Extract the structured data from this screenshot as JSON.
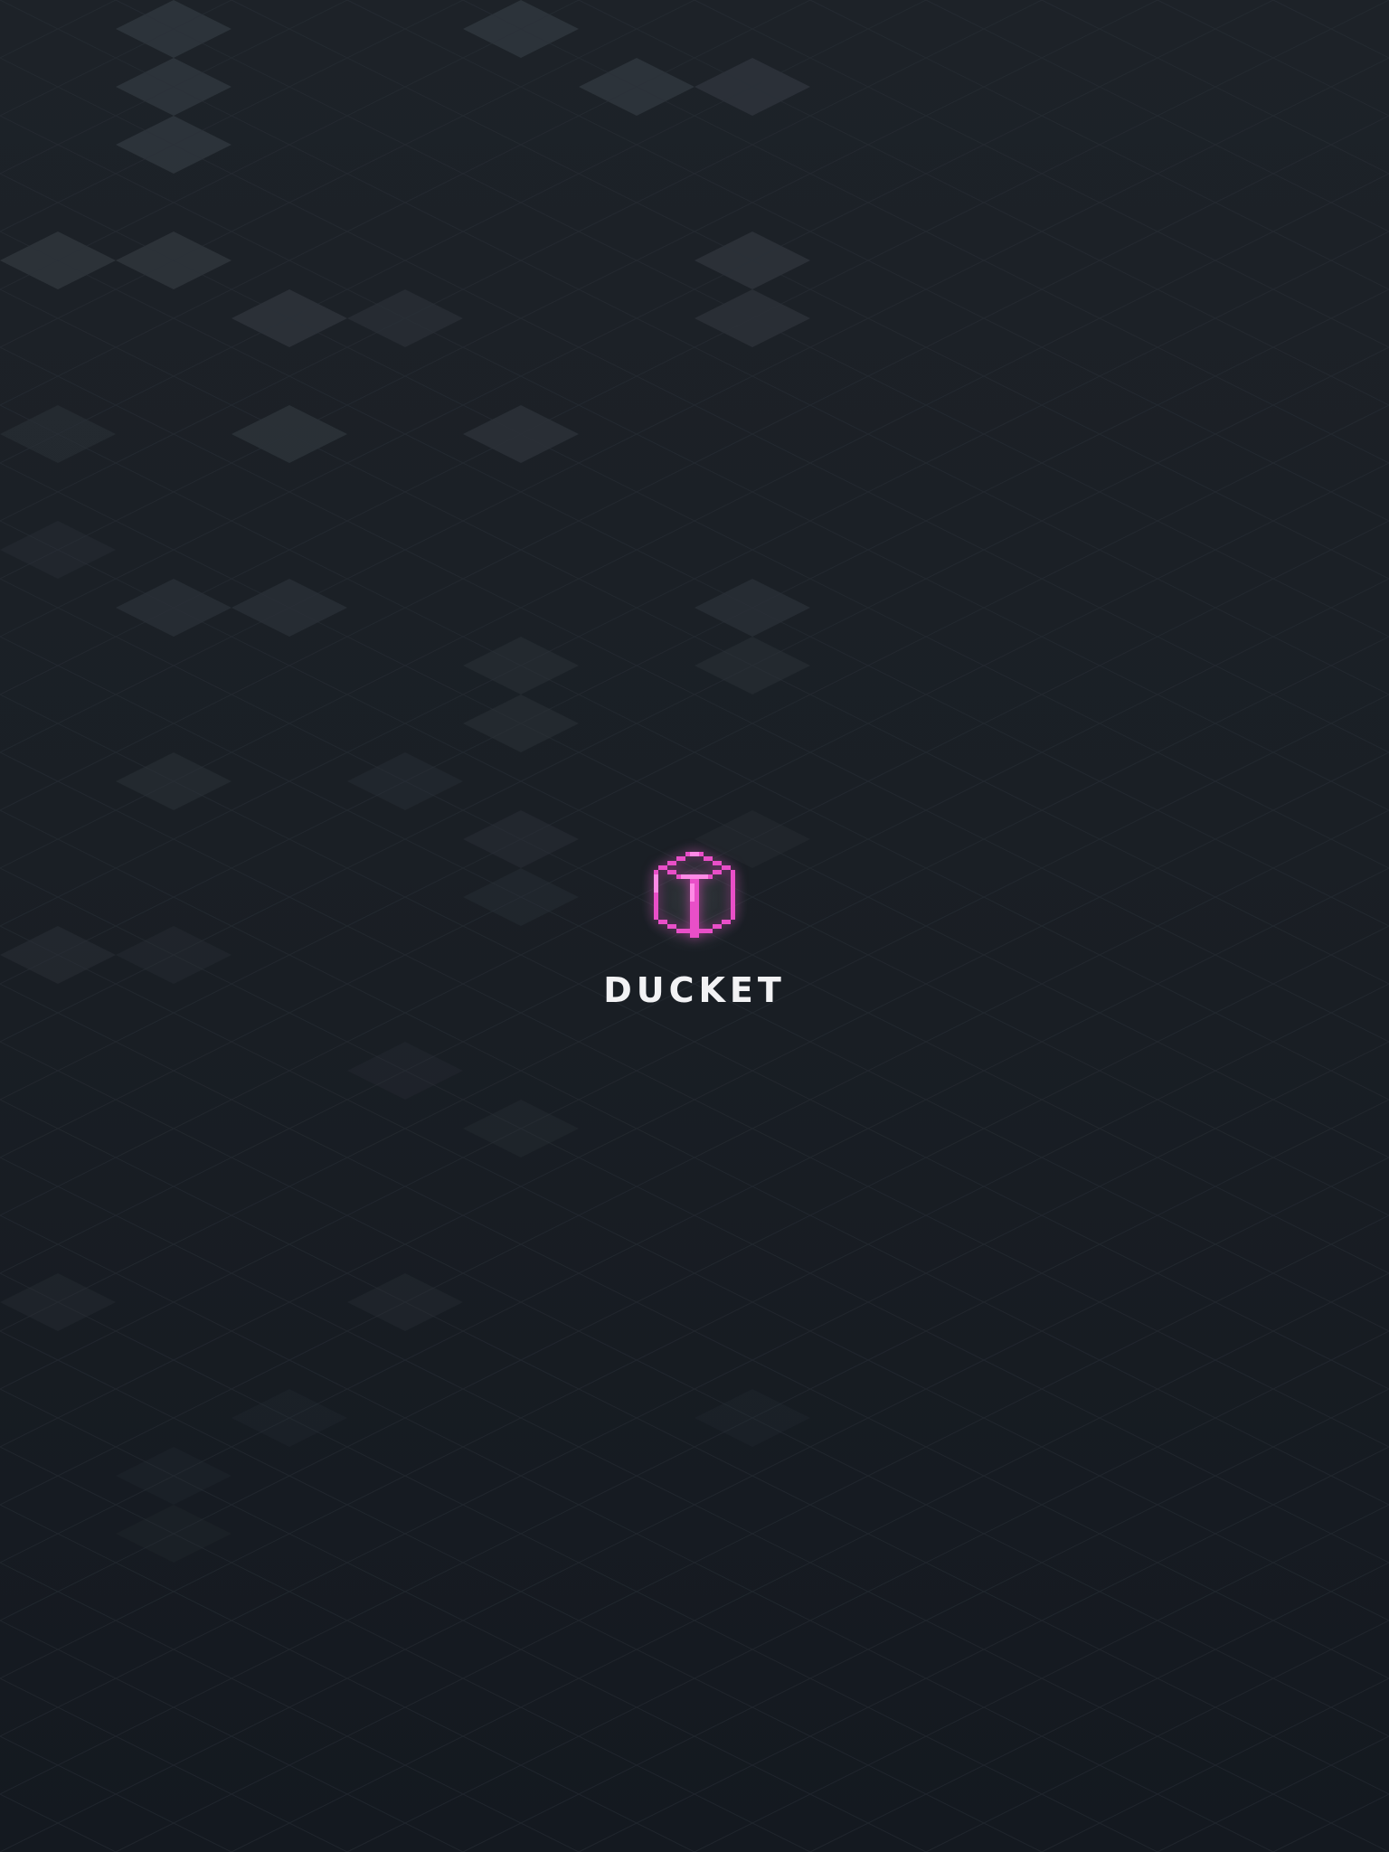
{
  "app": {
    "name": "DUCKET",
    "logo_icon": "pixel-cube-icon",
    "logo_color": "#e94fc8",
    "logo_highlight": "#ff8ae6"
  },
  "background": {
    "base_color_top": "#1d2228",
    "base_color_bottom": "#141920",
    "grid_line_color": "#2a3038",
    "tile_highlight_color": "#2c3238"
  }
}
